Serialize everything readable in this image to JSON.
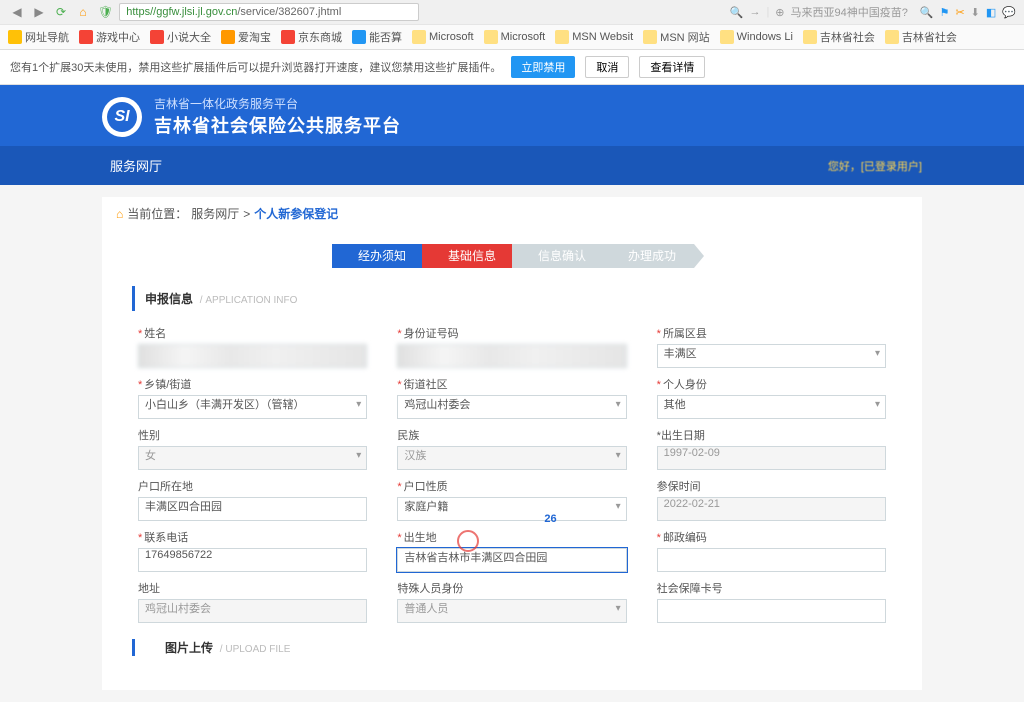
{
  "browser": {
    "url_scheme": "https",
    "url_domain": "//ggfw.jlsi.jl.gov.cn",
    "url_path": "/service/382607.jhtml",
    "right_text": "马来西亚94神中国疫苗?"
  },
  "bookmarks": {
    "items": [
      {
        "label": "网址导航"
      },
      {
        "label": "游戏中心"
      },
      {
        "label": "小说大全"
      },
      {
        "label": "爱淘宝"
      },
      {
        "label": "京东商城"
      },
      {
        "label": "能否算"
      },
      {
        "label": "Microsoft"
      },
      {
        "label": "Microsoft"
      },
      {
        "label": "MSN Websit"
      },
      {
        "label": "MSN 网站"
      },
      {
        "label": "Windows Li"
      },
      {
        "label": "吉林省社会"
      },
      {
        "label": "吉林省社会"
      }
    ]
  },
  "notify": {
    "text": "您有1个扩展30天未使用，禁用这些扩展插件后可以提升浏览器打开速度，建议您禁用这些扩展插件。",
    "btn_primary": "立即禁用",
    "btn_cancel": "取消",
    "btn_detail": "查看详情"
  },
  "site": {
    "subtitle": "吉林省一体化政务服务平台",
    "title": "吉林省社会保险公共服务平台",
    "nav_label": "服务网厅",
    "greeting": "您好，[已登录用户]"
  },
  "breadcrumb": {
    "prefix": "当前位置：",
    "lvl1": "服务网厅",
    "sep": " > ",
    "current": "个人新参保登记"
  },
  "steps": {
    "s1": "经办须知",
    "s2": "基础信息",
    "s3": "信息确认",
    "s4": "办理成功"
  },
  "section_app": {
    "title": "申报信息",
    "en": " / APPLICATION INFO"
  },
  "form": {
    "name": {
      "label": "姓名",
      "value": "████"
    },
    "idcard": {
      "label": "身份证号码",
      "value": "████████████"
    },
    "district": {
      "label": "所属区县",
      "value": "丰满区"
    },
    "township": {
      "label": "乡镇/街道",
      "value": "小白山乡（丰满开发区）（管辖）"
    },
    "community": {
      "label": "街道社区",
      "value": "鸡冠山村委会"
    },
    "identity": {
      "label": "个人身份",
      "value": "其他"
    },
    "gender": {
      "label": "性别",
      "value": "女"
    },
    "nation": {
      "label": "民族",
      "value": "汉族"
    },
    "birth": {
      "label": "出生日期",
      "value": "1997-02-09"
    },
    "hukou_addr": {
      "label": "户口所在地",
      "value": "丰满区四合田园"
    },
    "hukou_type": {
      "label": "户口性质",
      "value": "家庭户籍"
    },
    "insure_time": {
      "label": "参保时间",
      "value": "2022-02-21"
    },
    "phone": {
      "label": "联系电话",
      "value": "17649856722"
    },
    "birth_place": {
      "label": "出生地",
      "value": "吉林省吉林市丰满区四合田园",
      "cursor_pos": "26"
    },
    "postcode": {
      "label": "邮政编码",
      "value": ""
    },
    "address": {
      "label": "地址",
      "value": "鸡冠山村委会"
    },
    "special": {
      "label": "特殊人员身份",
      "value": "普通人员"
    },
    "sscard": {
      "label": "社会保障卡号",
      "value": ""
    }
  },
  "section_upload": {
    "title": "图片上传",
    "en": " / UPLOAD FILE"
  }
}
